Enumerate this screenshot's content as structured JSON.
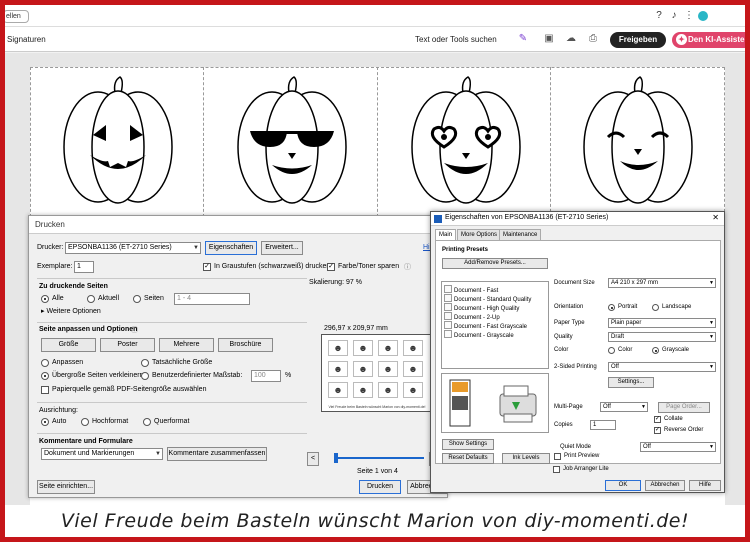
{
  "app": {
    "tab_pill": "ellen",
    "signatures": "Signaturen",
    "search_tools": "Text oder Tools suchen",
    "share_button": "Freigeben",
    "ai_button": "Den KI-Assisten"
  },
  "document": {
    "footer_text": "Viel Freude beim Basteln wünscht Marion von diy-momenti.de!"
  },
  "print_dialog": {
    "title": "Drucken",
    "printer_label": "Drucker:",
    "printer_value": "EPSONBA1136 (ET-2710 Series)",
    "properties_button": "Eigenschaften",
    "advanced_button": "Erweitert...",
    "help_link": "Hilfe",
    "copies_label": "Exemplare:",
    "copies_value": "1",
    "grayscale_label": "In Graustufen (schwarzweiß) drucken",
    "save_ink_label": "Farbe/Toner sparen",
    "pages_heading": "Zu druckende Seiten",
    "all_label": "Alle",
    "current_label": "Aktuell",
    "pages_label": "Seiten",
    "pages_range": "1 - 4",
    "more_options": "Weitere Optionen",
    "fit_heading": "Seite anpassen und Optionen",
    "size_button": "Größe",
    "poster_button": "Poster",
    "multiple_button": "Mehrere",
    "booklet_button": "Broschüre",
    "fit_label": "Anpassen",
    "actual_size_label": "Tatsächliche Größe",
    "shrink_label": "Übergroße Seiten verkleinern",
    "custom_scale_label": "Benutzerdefinierter Maßstab:",
    "custom_scale_value": "100",
    "percent": "%",
    "paper_source_label": "Papierquelle gemäß PDF-Seitengröße auswählen",
    "orientation_heading": "Ausrichtung:",
    "auto_label": "Auto",
    "portrait_label": "Hochformat",
    "landscape_label": "Querformat",
    "comments_heading": "Kommentare und Formulare",
    "comments_value": "Dokument und Markierungen",
    "summarize_button": "Kommentare zusammenfassen",
    "scaling_label": "Skalierung:  97 %",
    "dimensions_label": "296,97 x 209,97 mm",
    "page_indicator": "Seite 1 von 4",
    "page_setup_button": "Seite einrichten...",
    "print_button": "Drucken",
    "cancel_button": "Abbrechen",
    "preview_caption": "Viel Freude beim Basteln wünscht Marion von diy-momenti.de!",
    "prev_page": "<",
    "next_page": ">"
  },
  "epson_dialog": {
    "title": "Eigenschaften von EPSONBA1136 (ET-2710 Series)",
    "tabs": [
      "Main",
      "More Options",
      "Maintenance"
    ],
    "presets_heading": "Printing Presets",
    "add_remove_button": "Add/Remove Presets...",
    "presets": [
      "Document - Fast",
      "Document - Standard Quality",
      "Document - High Quality",
      "Document - 2-Up",
      "Document - Fast Grayscale",
      "Document - Grayscale"
    ],
    "document_size_label": "Document Size",
    "document_size_value": "A4 210 x 297 mm",
    "orientation_label": "Orientation",
    "portrait_label": "Portrait",
    "landscape_label": "Landscape",
    "paper_type_label": "Paper Type",
    "paper_type_value": "Plain paper",
    "quality_label": "Quality",
    "quality_value": "Draft",
    "color_label": "Color",
    "color_option": "Color",
    "grayscale_option": "Grayscale",
    "two_sided_label": "2-Sided Printing",
    "two_sided_value": "Off",
    "settings_button": "Settings...",
    "multi_page_label": "Multi-Page",
    "multi_page_value": "Off",
    "page_order_button": "Page Order...",
    "copies_label": "Copies",
    "copies_value": "1",
    "collate_label": "Collate",
    "reverse_order_label": "Reverse Order",
    "quiet_mode_label": "Quiet Mode",
    "quiet_mode_value": "Off",
    "print_preview_label": "Print Preview",
    "job_arranger_label": "Job Arranger Lite",
    "show_settings_button": "Show Settings",
    "reset_defaults_button": "Reset Defaults",
    "ink_levels_button": "Ink Levels",
    "ok_button": "OK",
    "cancel_button": "Abbrechen",
    "help_button": "Hilfe"
  },
  "colors": {
    "frame_red": "#c5161a",
    "share_dark": "#222222",
    "ai_pink": "#e0446b",
    "link_blue": "#1a55c4",
    "slider_blue": "#1a66cc"
  }
}
